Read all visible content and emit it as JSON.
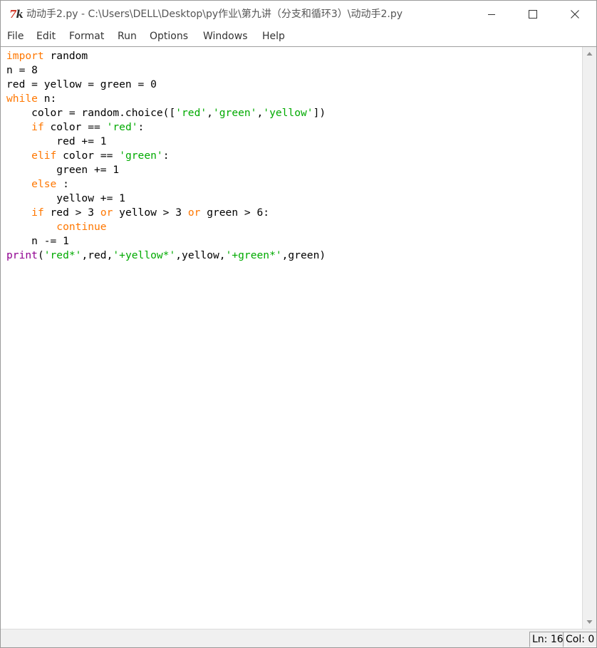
{
  "window": {
    "title": "动动手2.py - C:\\Users\\DELL\\Desktop\\py作业\\第九讲（分支和循环3）\\动动手2.py",
    "icon_name": "idle-tk-icon",
    "controls": [
      "minimize-icon",
      "maximize-icon",
      "close-icon"
    ]
  },
  "menu": {
    "items": [
      "File",
      "Edit",
      "Format",
      "Run",
      "Options",
      "Windows",
      "Help"
    ]
  },
  "editor": {
    "syntax_colors": {
      "keyword": "#ff7700",
      "string": "#00aa00",
      "builtin": "#900090",
      "default": "#000000"
    },
    "lines": [
      [
        {
          "t": "import",
          "c": "kw"
        },
        {
          "t": " random"
        }
      ],
      [
        {
          "t": "n = 8"
        }
      ],
      [
        {
          "t": "red = yellow = green = 0"
        }
      ],
      [
        {
          "t": "while",
          "c": "kw"
        },
        {
          "t": " n:"
        }
      ],
      [
        {
          "t": "    color = random.choice(["
        },
        {
          "t": "'red'",
          "c": "str"
        },
        {
          "t": ","
        },
        {
          "t": "'green'",
          "c": "str"
        },
        {
          "t": ","
        },
        {
          "t": "'yellow'",
          "c": "str"
        },
        {
          "t": "])"
        }
      ],
      [
        {
          "t": "    "
        },
        {
          "t": "if",
          "c": "kw"
        },
        {
          "t": " color == "
        },
        {
          "t": "'red'",
          "c": "str"
        },
        {
          "t": ":"
        }
      ],
      [
        {
          "t": "        red += 1"
        }
      ],
      [
        {
          "t": "    "
        },
        {
          "t": "elif",
          "c": "kw"
        },
        {
          "t": " color == "
        },
        {
          "t": "'green'",
          "c": "str"
        },
        {
          "t": ":"
        }
      ],
      [
        {
          "t": "        green += 1"
        }
      ],
      [
        {
          "t": "    "
        },
        {
          "t": "else",
          "c": "kw"
        },
        {
          "t": " :"
        }
      ],
      [
        {
          "t": "        yellow += 1"
        }
      ],
      [
        {
          "t": "    "
        },
        {
          "t": "if",
          "c": "kw"
        },
        {
          "t": " red > 3 "
        },
        {
          "t": "or",
          "c": "kw"
        },
        {
          "t": " yellow > 3 "
        },
        {
          "t": "or",
          "c": "kw"
        },
        {
          "t": " green > 6:"
        }
      ],
      [
        {
          "t": "        "
        },
        {
          "t": "continue",
          "c": "kw"
        }
      ],
      [
        {
          "t": "    n -= 1"
        }
      ],
      [
        {
          "t": "print",
          "c": "bi"
        },
        {
          "t": "("
        },
        {
          "t": "'red*'",
          "c": "str"
        },
        {
          "t": ",red,"
        },
        {
          "t": "'+yellow*'",
          "c": "str"
        },
        {
          "t": ",yellow,"
        },
        {
          "t": "'+green*'",
          "c": "str"
        },
        {
          "t": ",green)"
        }
      ]
    ]
  },
  "status": {
    "ln": "Ln: 16",
    "col": "Col: 0"
  }
}
